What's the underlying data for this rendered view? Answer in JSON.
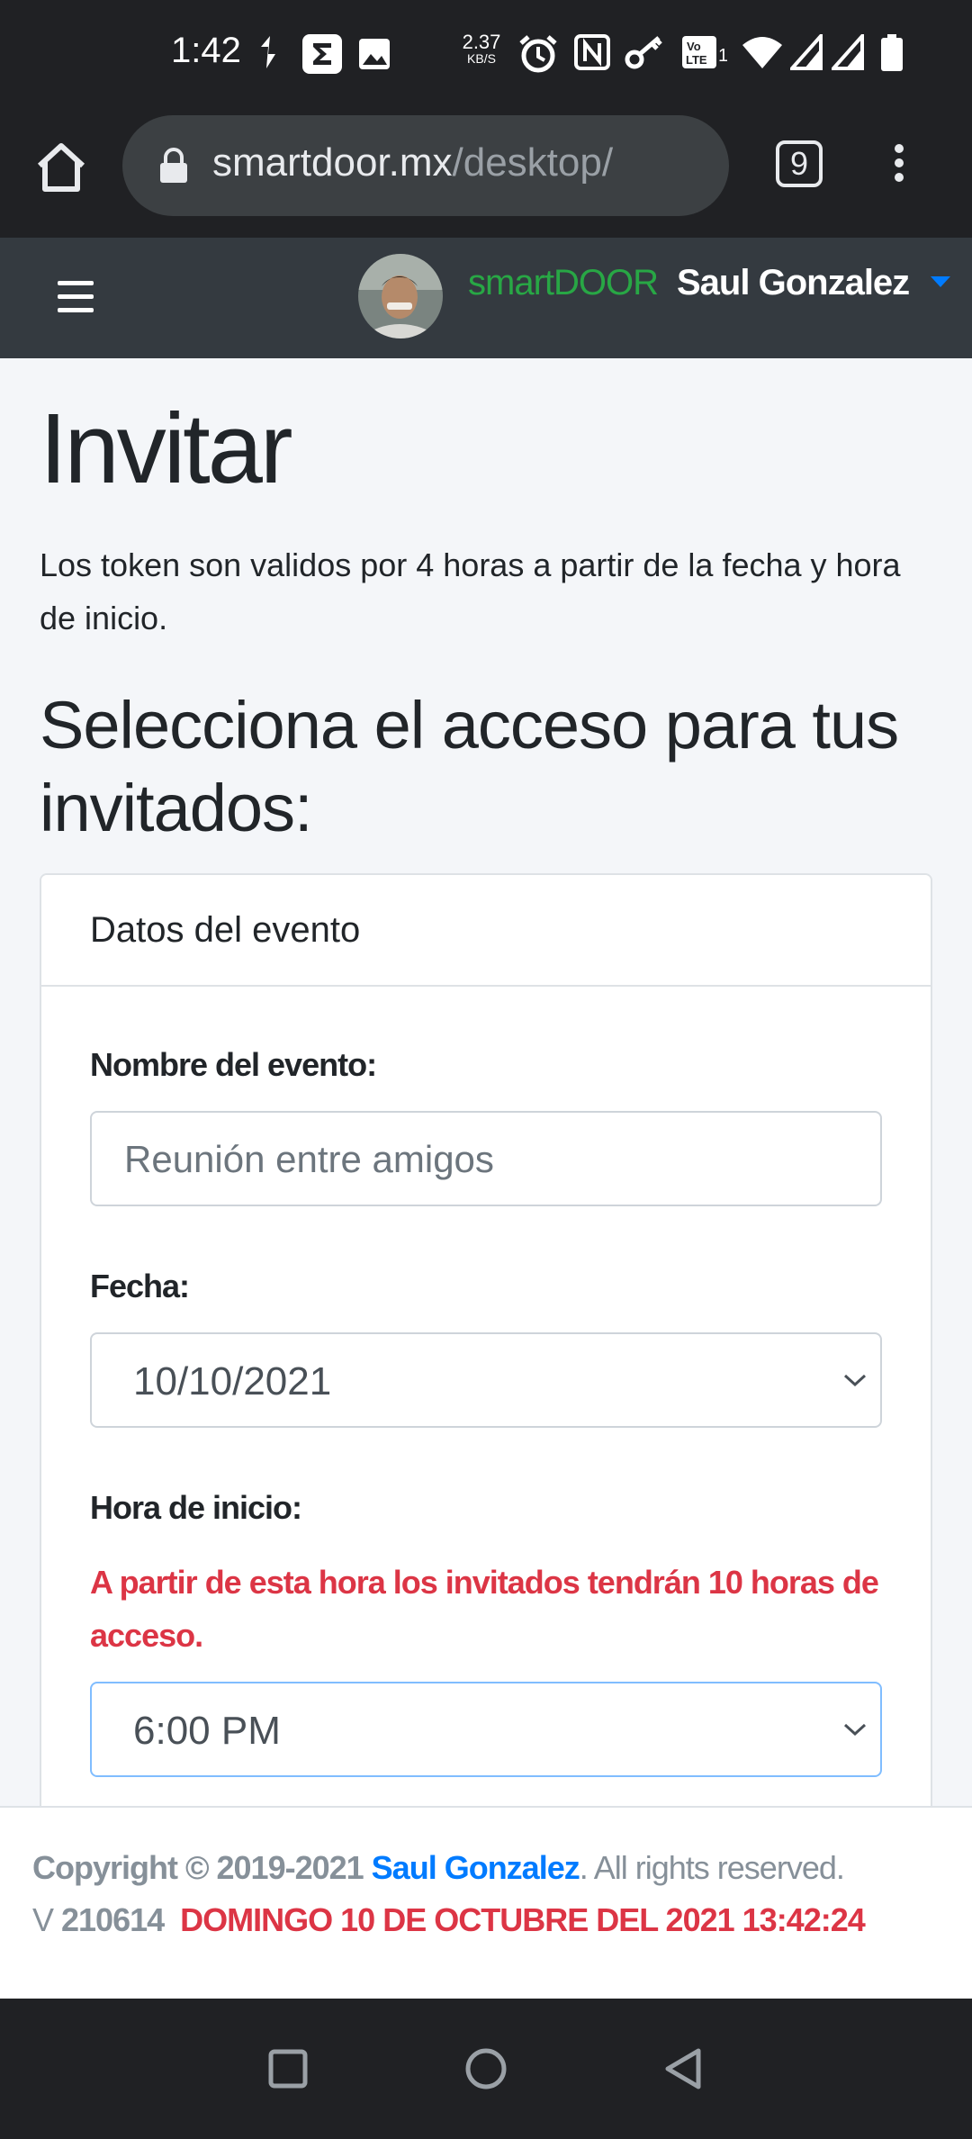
{
  "status_bar": {
    "time": "1:42",
    "speed_value": "2.37",
    "speed_unit": "KB/S",
    "icons": [
      "notification-icon",
      "sigma-app-icon",
      "gallery-icon",
      "alarm-icon",
      "nfc-icon",
      "key-icon",
      "volte-icon",
      "wifi-icon",
      "signal-icon",
      "signal-icon",
      "battery-icon"
    ]
  },
  "browser": {
    "url_host": "smartdoor.mx",
    "url_path": "/desktop/",
    "tab_count": "9"
  },
  "navbar": {
    "brand": "smartDOOR",
    "user_name": "Saul Gonzalez"
  },
  "page": {
    "title": "Invitar",
    "description": "Los token son validos por 4 horas a partir de la fecha y hora de inicio.",
    "subtitle": "Selecciona el acceso para tus invitados:"
  },
  "card": {
    "header": "Datos del evento",
    "event_name_label": "Nombre del evento:",
    "event_name_placeholder": "Reunión entre amigos",
    "date_label": "Fecha:",
    "date_value": "10/10/2021",
    "start_label": "Hora de inicio:",
    "start_warning": "A partir de esta hora los invitados tendrán 10 horas de acceso.",
    "start_value": "6:00 PM"
  },
  "footer": {
    "copyright_prefix": "Copyright © 2019-2021 ",
    "author": "Saul Gonzalez",
    "rights": ". All rights reserved.",
    "version_prefix": "V ",
    "version": "210614",
    "datetime": "DOMINGO 10 DE OCTUBRE DEL 2021 13:42:24"
  },
  "colors": {
    "brand_green": "#28a745",
    "link_blue": "#007bff",
    "danger_red": "#dc3545",
    "navbar_bg": "#343a40"
  }
}
